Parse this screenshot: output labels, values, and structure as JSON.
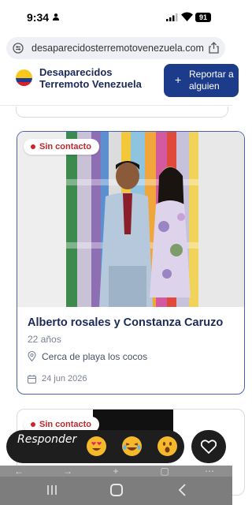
{
  "status_bar": {
    "time": "9:34",
    "battery": "91",
    "icons": [
      "person-icon",
      "signal-icon",
      "wifi-icon",
      "battery-icon"
    ]
  },
  "url_bar": {
    "url": "desaparecidosterremotovenezuela.com",
    "icons": [
      "tune-icon",
      "share-icon"
    ]
  },
  "header": {
    "site_title": "Desaparecidos\nTerremoto Venezuela",
    "report_button": {
      "plus": "+",
      "label": "Reportar a\nalguien"
    },
    "logo_colors": [
      "#f7c81b",
      "#1f3a93",
      "#d8202a"
    ]
  },
  "cards": [
    {
      "status": "Sin contacto",
      "name": "Alberto rosales y Constanza Caruzo",
      "age": "22 años",
      "location": "Cerca de playa los cocos",
      "date": "24 jun 2026",
      "photo_icon": "couple-photo"
    },
    {
      "status": "Sin contacto",
      "photo_icon": "dark-photo"
    }
  ],
  "reaction_bar": {
    "reply_placeholder": "Responder",
    "emojis": [
      "heart-eyes-emoji",
      "laughing-emoji",
      "surprised-emoji"
    ],
    "heart_icon": "heart-icon"
  },
  "nav_bar": {
    "icons": [
      "recents-icon",
      "home-icon",
      "back-icon"
    ]
  },
  "colors": {
    "accent": "#1d3b8b",
    "status_red": "#c0262d",
    "card_border": "#4b62b0",
    "title": "#1c2a5a"
  }
}
